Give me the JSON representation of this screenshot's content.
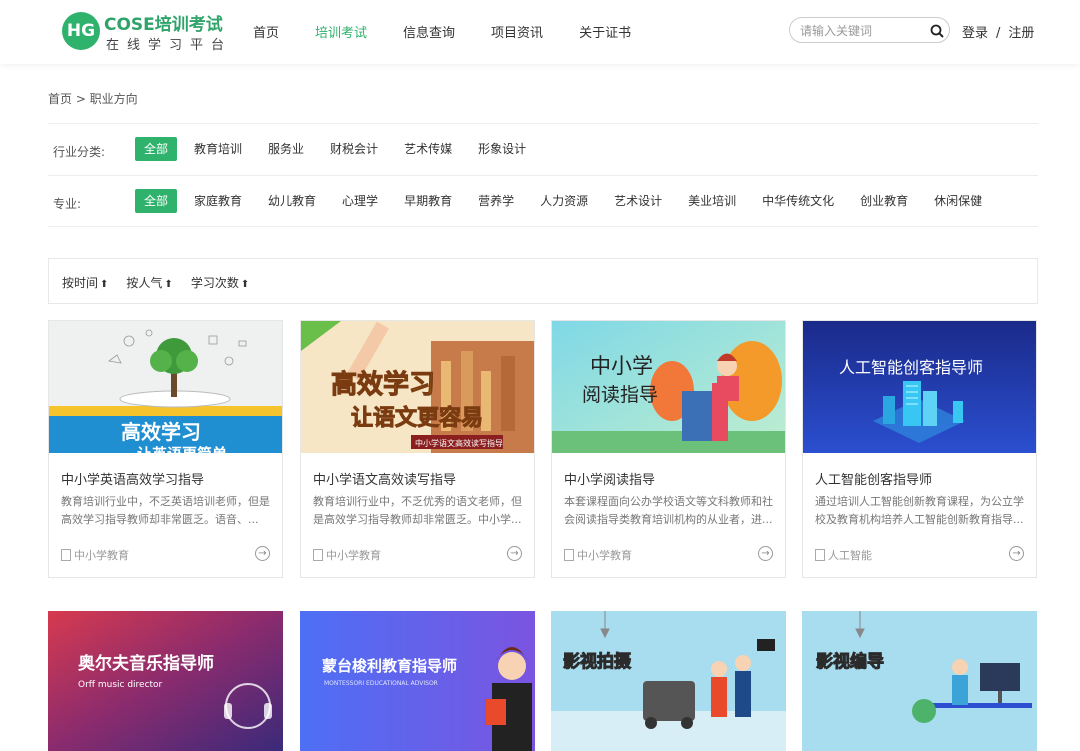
{
  "header": {
    "logo_mark": "HG",
    "logo_title": "COSE培训考试",
    "logo_sub": "在线学习平台",
    "nav": [
      "首页",
      "培训考试",
      "信息查询",
      "项目资讯",
      "关于证书"
    ],
    "active_nav": 1,
    "search_placeholder": "请输入关键词",
    "login": "登录",
    "sep": "/",
    "register": "注册",
    "accent": "#2fb26c"
  },
  "breadcrumb": "首页 > 职业方向",
  "filters": {
    "industry": {
      "label": "行业分类:",
      "options": [
        "全部",
        "教育培训",
        "服务业",
        "财税会计",
        "艺术传媒",
        "形象设计"
      ],
      "active": 0
    },
    "major": {
      "label": "专业:",
      "options": [
        "全部",
        "家庭教育",
        "幼儿教育",
        "心理学",
        "早期教育",
        "营养学",
        "人力资源",
        "艺术设计",
        "美业培训",
        "中华传统文化",
        "创业教育",
        "休闲保健"
      ],
      "active": 0
    }
  },
  "sort": [
    "按时间",
    "按人气",
    "学习次数"
  ],
  "sort_arrow": "⬆",
  "cards": [
    {
      "title": "中小学英语高效学习指导",
      "desc": "  教育培训行业中，不乏英语培训老师，但是高效学习指导教师却非常匮乏。语音、...",
      "tag": "中小学教育",
      "cover_text": "高效学习",
      "cover_text2": "让英语更简单"
    },
    {
      "title": "中小学语文高效读写指导",
      "desc": "教育培训行业中，不乏优秀的语文老师，但是高效学习指导教师却非常匮乏。中小学...",
      "tag": "中小学教育",
      "cover_text": "高效学习",
      "cover_text2": "让语文更容易",
      "cover_small": "中小学语文高效读写指导"
    },
    {
      "title": "中小学阅读指导",
      "desc": "本套课程面向公办学校语文等文科教师和社会阅读指导类教育培训机构的从业者，进...",
      "tag": "中小学教育",
      "cover_text": "中小学",
      "cover_text2": "阅读指导"
    },
    {
      "title": "人工智能创客指导师",
      "desc": "通过培训人工智能创新教育课程，为公立学校及教育机构培养人工智能创新教育指导...",
      "tag": "人工智能",
      "cover_text": "人工智能创客指导师"
    }
  ],
  "cards_row2": [
    {
      "cover_text": "奥尔夫音乐指导师",
      "cover_sub": "Orff music director"
    },
    {
      "cover_text": "蒙台梭利教育指导师",
      "cover_sub": "MONTESSORI EDUCATIONAL ADVISOR"
    },
    {
      "cover_text": "影视拍摄"
    },
    {
      "cover_text": "影视编导"
    }
  ]
}
